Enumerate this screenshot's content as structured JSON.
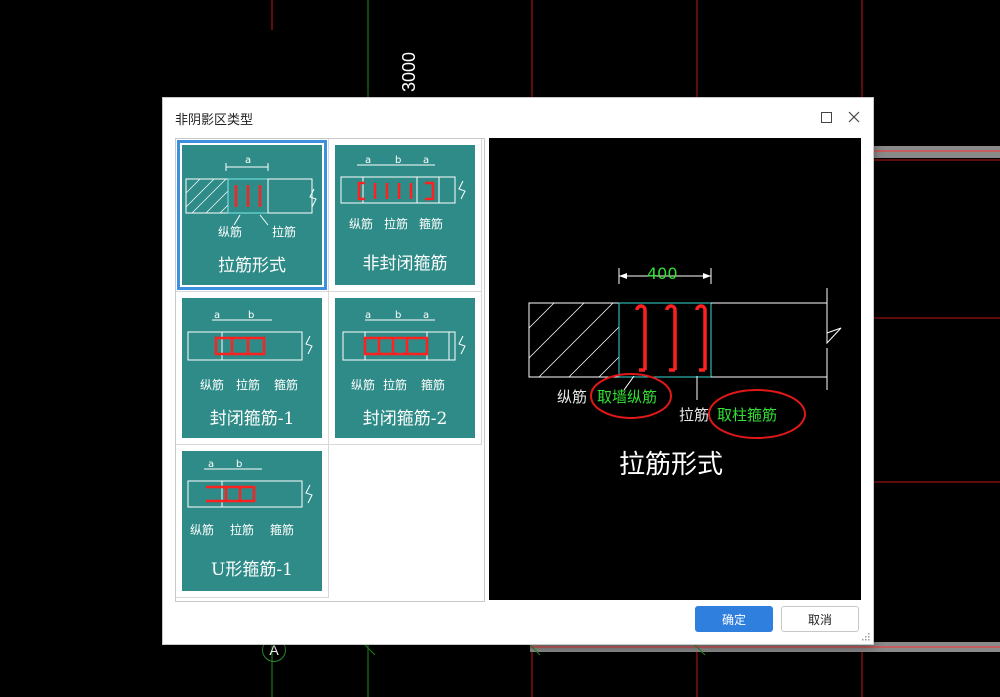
{
  "background": {
    "dimension_label": "3000",
    "axis_label": "A"
  },
  "dialog": {
    "title": "非阴影区类型",
    "maximize_icon": "maximize-icon",
    "close_icon": "close-icon",
    "ok_label": "确定",
    "cancel_label": "取消"
  },
  "options": [
    {
      "label": "拉筋形式",
      "dims": [
        "a"
      ],
      "parts": [
        "纵筋",
        "拉筋"
      ],
      "selected": true
    },
    {
      "label": "非封闭箍筋",
      "dims": [
        "a",
        "b",
        "a"
      ],
      "parts": [
        "纵筋",
        "拉筋",
        "箍筋"
      ],
      "selected": false
    },
    {
      "label": "封闭箍筋-1",
      "dims": [
        "a",
        "b"
      ],
      "parts": [
        "纵筋",
        "拉筋",
        "箍筋"
      ],
      "selected": false
    },
    {
      "label": "封闭箍筋-2",
      "dims": [
        "a",
        "b",
        "a"
      ],
      "parts": [
        "纵筋",
        "拉筋",
        "箍筋"
      ],
      "selected": false
    },
    {
      "label": "U形箍筋-1",
      "dims": [
        "a",
        "b"
      ],
      "parts": [
        "纵筋",
        "拉筋",
        "箍筋"
      ],
      "selected": false
    }
  ],
  "preview": {
    "dimension": "400",
    "longitudinal_label": "纵筋",
    "longitudinal_value": "取墙纵筋",
    "tie_label": "拉筋",
    "tie_value": "取柱箍筋",
    "title": "拉筋形式",
    "colors": {
      "dimension": "#33e033",
      "rebar": "#ff2020",
      "highlight": "#e01818"
    }
  }
}
